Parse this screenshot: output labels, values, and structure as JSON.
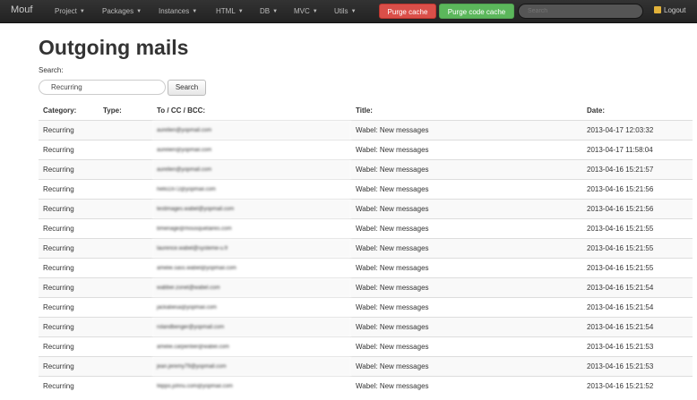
{
  "navbar": {
    "brand": "Mouf",
    "menus": [
      "Project",
      "Packages",
      "Instances",
      "HTML",
      "DB",
      "MVC",
      "Utils"
    ],
    "purge_cache_label": "Purge cache",
    "purge_code_cache_label": "Purge code cache",
    "search_placeholder": "Search",
    "logout_label": "Logout"
  },
  "page": {
    "title": "Outgoing mails",
    "search_label": "Search:",
    "search_value": "Recurring",
    "search_button_label": "Search"
  },
  "table": {
    "columns": [
      "Category:",
      "Type:",
      "To / CC / BCC:",
      "Title:",
      "Date:"
    ],
    "rows": [
      {
        "category": "Recurring",
        "type": "",
        "to": "aurelien@yopmail.com",
        "title": "Wabel: New messages",
        "date": "2013-04-17 12:03:32"
      },
      {
        "category": "Recurring",
        "type": "",
        "to": "aurelien@yopmail.com",
        "title": "Wabel: New messages",
        "date": "2013-04-17 11:58:04"
      },
      {
        "category": "Recurring",
        "type": "",
        "to": "aurelien@yopmail.com",
        "title": "Wabel: New messages",
        "date": "2013-04-16 15:21:57"
      },
      {
        "category": "Recurring",
        "type": "",
        "to": "hello1972@yopmail.com",
        "title": "Wabel: New messages",
        "date": "2013-04-16 15:21:56"
      },
      {
        "category": "Recurring",
        "type": "",
        "to": "testimages.wabel@yopmail.com",
        "title": "Wabel: New messages",
        "date": "2013-04-16 15:21:56"
      },
      {
        "category": "Recurring",
        "type": "",
        "to": "bmenage@mousquetaires.com",
        "title": "Wabel: New messages",
        "date": "2013-04-16 15:21:55"
      },
      {
        "category": "Recurring",
        "type": "",
        "to": "laurence.wabel@systeme-u.fr",
        "title": "Wabel: New messages",
        "date": "2013-04-16 15:21:55"
      },
      {
        "category": "Recurring",
        "type": "",
        "to": "amelie.sass.wabel@yopmail.com",
        "title": "Wabel: New messages",
        "date": "2013-04-16 15:21:55"
      },
      {
        "category": "Recurring",
        "type": "",
        "to": "wabber.zonet@wabel.com",
        "title": "Wabel: New messages",
        "date": "2013-04-16 15:21:54"
      },
      {
        "category": "Recurring",
        "type": "",
        "to": "jackabesa@yopmail.com",
        "title": "Wabel: New messages",
        "date": "2013-04-16 15:21:54"
      },
      {
        "category": "Recurring",
        "type": "",
        "to": "rolandbenger@yopmail.com",
        "title": "Wabel: New messages",
        "date": "2013-04-16 15:21:54"
      },
      {
        "category": "Recurring",
        "type": "",
        "to": "amelie.carpentier@wabel.com",
        "title": "Wabel: New messages",
        "date": "2013-04-16 15:21:53"
      },
      {
        "category": "Recurring",
        "type": "",
        "to": "jean.jeremy79@yopmail.com",
        "title": "Wabel: New messages",
        "date": "2013-04-16 15:21:53"
      },
      {
        "category": "Recurring",
        "type": "",
        "to": "filippo.johnu.com@yopmail.com",
        "title": "Wabel: New messages",
        "date": "2013-04-16 15:21:52"
      }
    ]
  }
}
